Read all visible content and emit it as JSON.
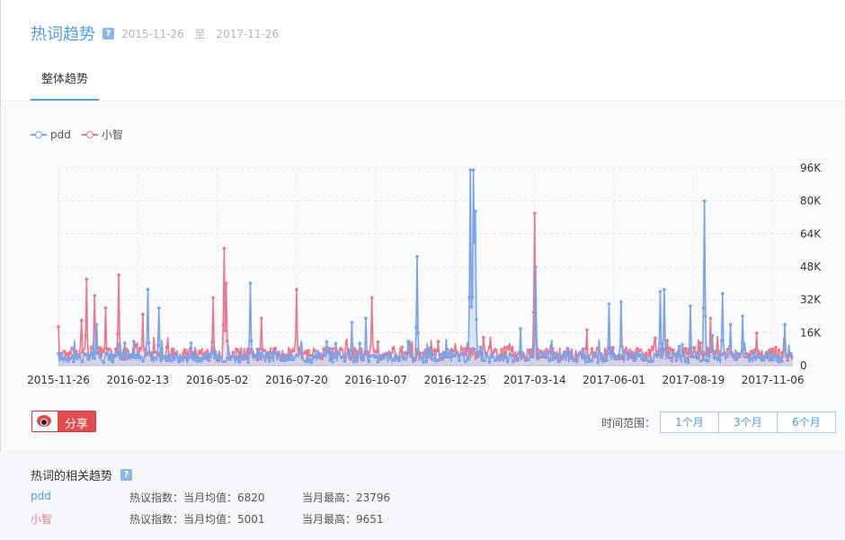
{
  "header": {
    "title": "热词趋势",
    "help": "?",
    "date_from": "2015-11-26",
    "date_sep": "至",
    "date_to": "2017-11-26"
  },
  "tabs": [
    {
      "label": "整体趋势",
      "active": true
    }
  ],
  "chart_data": {
    "type": "area",
    "series": [
      {
        "name": "pdd",
        "color": "#7ba3e8",
        "peaks": [
          [
            "2016-01-03",
            20000
          ],
          [
            "2016-01-27",
            8000
          ],
          [
            "2016-02-23",
            37000
          ],
          [
            "2016-03-05",
            28000
          ],
          [
            "2016-05-13",
            10000
          ],
          [
            "2016-06-04",
            40000
          ],
          [
            "2016-07-25",
            12000
          ],
          [
            "2016-09-13",
            21000
          ],
          [
            "2016-09-27",
            23000
          ],
          [
            "2016-11-17",
            53000
          ],
          [
            "2017-01-09",
            95000
          ],
          [
            "2017-01-12",
            95000
          ],
          [
            "2017-01-13",
            60000
          ],
          [
            "2017-01-14",
            75000
          ],
          [
            "2017-02-28",
            18000
          ],
          [
            "2017-03-15",
            48000
          ],
          [
            "2017-05-01",
            8000
          ],
          [
            "2017-05-27",
            30000
          ],
          [
            "2017-06-08",
            31000
          ],
          [
            "2017-07-17",
            36000
          ],
          [
            "2017-07-21",
            37000
          ],
          [
            "2017-08-16",
            29000
          ],
          [
            "2017-08-30",
            80000
          ],
          [
            "2017-09-17",
            35000
          ],
          [
            "2017-09-25",
            20000
          ],
          [
            "2017-10-07",
            24000
          ],
          [
            "2017-11-18",
            20000
          ]
        ]
      },
      {
        "name": "小智",
        "color": "#e9788d",
        "peaks": [
          [
            "2015-11-26",
            19000
          ],
          [
            "2015-12-19",
            22000
          ],
          [
            "2015-12-24",
            42000
          ],
          [
            "2016-01-01",
            34000
          ],
          [
            "2016-01-12",
            28000
          ],
          [
            "2016-01-25",
            44000
          ],
          [
            "2016-02-18",
            25000
          ],
          [
            "2016-04-28",
            33000
          ],
          [
            "2016-05-09",
            57000
          ],
          [
            "2016-05-11",
            40000
          ],
          [
            "2016-06-15",
            23000
          ],
          [
            "2016-07-20",
            37000
          ],
          [
            "2016-09-14",
            11000
          ],
          [
            "2016-10-03",
            33000
          ],
          [
            "2016-11-10",
            12000
          ],
          [
            "2017-01-10",
            8000
          ],
          [
            "2017-03-14",
            74000
          ],
          [
            "2017-09-05",
            23000
          ]
        ]
      }
    ],
    "xlabel": "",
    "ylabel": "",
    "xrange": [
      "2015-11-26",
      "2017-11-26"
    ],
    "ylim": [
      0,
      96000
    ],
    "yticks": [
      "0",
      "16K",
      "32K",
      "48K",
      "64K",
      "80K",
      "96K"
    ],
    "xticks": [
      "2015-11-26",
      "2016-02-13",
      "2016-05-02",
      "2016-07-20",
      "2016-10-07",
      "2016-12-25",
      "2017-03-14",
      "2017-06-01",
      "2017-08-19",
      "2017-11-06"
    ],
    "legend_position": "top-left",
    "grid": true
  },
  "share": {
    "label": "分享"
  },
  "timerange": {
    "label": "时间范围：",
    "options": [
      "1个月",
      "3个月",
      "6个月"
    ]
  },
  "related": {
    "title": "热词的相关趋势",
    "rows": [
      {
        "name": "pdd",
        "color": "#4d9de0",
        "avg": "热议指数：当月均值：6820",
        "max": "当月最高：23796"
      },
      {
        "name": "小智",
        "color": "#e9788d",
        "avg": "热议指数：当月均值：5001",
        "max": "当月最高：9651"
      }
    ]
  }
}
